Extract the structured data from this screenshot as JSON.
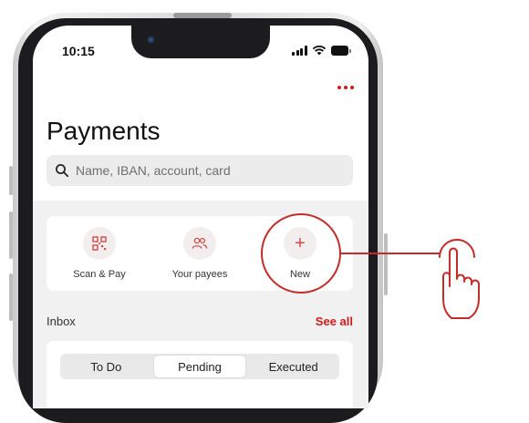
{
  "status_bar": {
    "time": "10:15"
  },
  "header": {
    "title": "Payments",
    "more_icon": "more-dots-icon"
  },
  "search": {
    "placeholder": "Name, IBAN, account, card",
    "icon": "search-icon"
  },
  "quick_actions": [
    {
      "label": "Scan & Pay",
      "icon": "qr-code-icon"
    },
    {
      "label": "Your payees",
      "icon": "people-icon"
    },
    {
      "label": "New",
      "icon": "plus-icon"
    }
  ],
  "inbox": {
    "title": "Inbox",
    "see_all": "See all",
    "tabs": [
      {
        "label": "To Do",
        "active": false
      },
      {
        "label": "Pending",
        "active": true
      },
      {
        "label": "Executed",
        "active": false
      }
    ]
  },
  "colors": {
    "accent": "#d11a1a",
    "highlight_ring": "#c42b2b",
    "background": "#f1f1f1"
  }
}
